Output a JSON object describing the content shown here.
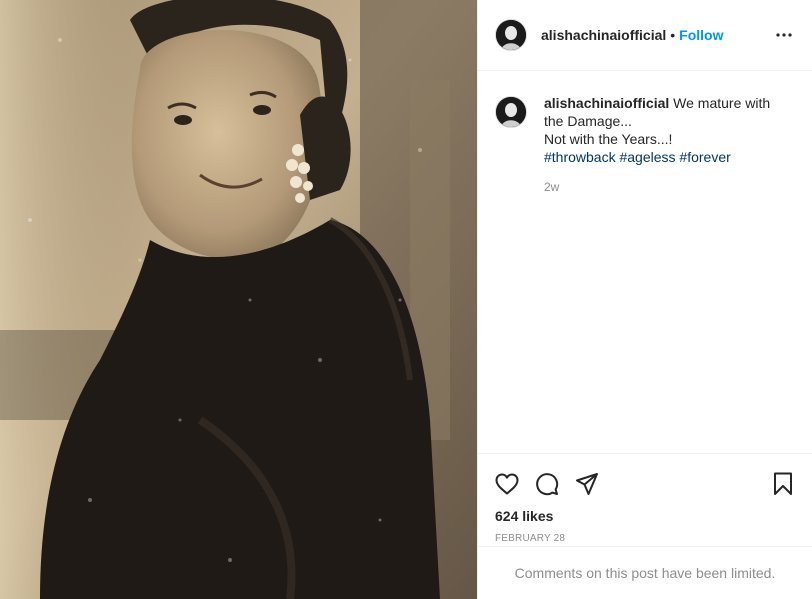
{
  "post": {
    "photo_icon": "vintage-portrait-photo",
    "author": {
      "username": "alishachinaiofficial",
      "follow_label": "Follow",
      "separator": "•"
    },
    "menu_icon": "more-horizontal-icon",
    "caption": {
      "username": "alishachinaiofficial",
      "line1": "We mature with the Damage...",
      "line2": "Not with the Years...!",
      "hashtags": [
        "#throwback",
        "#ageless",
        "#forever"
      ],
      "time_ago": "2w"
    },
    "actions": {
      "like_icon": "heart-icon",
      "comment_icon": "comment-icon",
      "share_icon": "send-icon",
      "save_icon": "bookmark-icon"
    },
    "likes": "624 likes",
    "date": "February 28",
    "comments_notice": "Comments on this post have been limited."
  }
}
